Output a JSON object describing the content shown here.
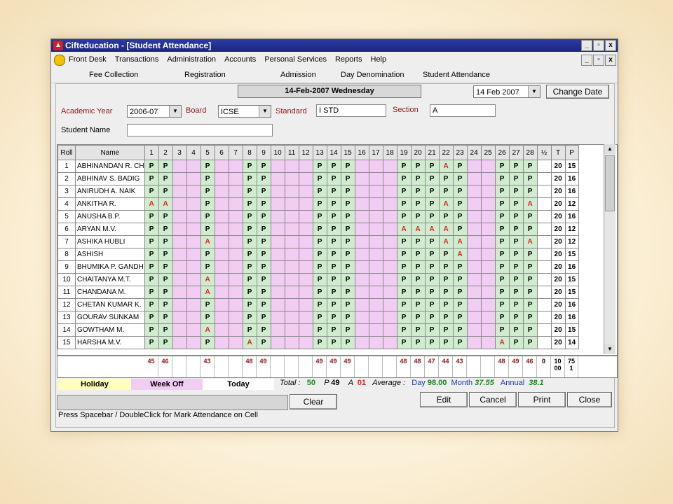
{
  "window": {
    "title": "Cifteducation - [Student Attendance]",
    "min_btn": "_",
    "restore_btn": "▫",
    "close_btn": "x"
  },
  "menu": [
    "Front Desk",
    "Transactions",
    "Administration",
    "Accounts",
    "Personal Services",
    "Reports",
    "Help"
  ],
  "toolbar": [
    "Fee Collection",
    "Registration",
    "Admission",
    "Day Denomination",
    "Student Attendance"
  ],
  "date_display": "14-Feb-2007  Wednesday",
  "date_select": "14 Feb 2007",
  "change_date_label": "Change Date",
  "filters": {
    "academic_year_label": "Academic Year",
    "academic_year": "2006-07",
    "board_label": "Board",
    "board": "ICSE",
    "standard_label": "Standard",
    "standard": "I STD",
    "section_label": "Section",
    "section": "A",
    "student_name_label": "Student Name",
    "student_name": ""
  },
  "grid": {
    "headers": [
      "Roll",
      "Name",
      "1",
      "2",
      "3",
      "4",
      "5",
      "6",
      "7",
      "8",
      "9",
      "10",
      "11",
      "12",
      "13",
      "14",
      "15",
      "16",
      "17",
      "18",
      "19",
      "20",
      "21",
      "22",
      "23",
      "24",
      "25",
      "26",
      "27",
      "28",
      "½",
      "T",
      "P"
    ],
    "holiday_cols": [
      3,
      4,
      6,
      7,
      10,
      11,
      12,
      16,
      17,
      18,
      24,
      25
    ],
    "rows": [
      {
        "roll": "1",
        "name": "ABHINANDAN R. CH",
        "marks": "PP..P..PP...PPP...PPPAP..PPP",
        "t": "20",
        "p": "15"
      },
      {
        "roll": "2",
        "name": "ABHINAV S. BADIG",
        "marks": "PP..P..PP...PPP...PPPPP..PPP",
        "t": "20",
        "p": "16"
      },
      {
        "roll": "3",
        "name": "ANIRUDH A. NAIK",
        "marks": "PP..P..PP...PPP...PPPPP..PPP",
        "t": "20",
        "p": "16"
      },
      {
        "roll": "4",
        "name": "ANKITHA R.",
        "marks": "AA..P..PP...PPP...PPPAP..PPA",
        "t": "20",
        "p": "12"
      },
      {
        "roll": "5",
        "name": "ANUSHA B.P.",
        "marks": "PP..P..PP...PPP...PPPPP..PPP",
        "t": "20",
        "p": "16"
      },
      {
        "roll": "6",
        "name": "ARYAN M.V.",
        "marks": "PP..P..PP...PPP...AAAAP..PPP",
        "t": "20",
        "p": "12"
      },
      {
        "roll": "7",
        "name": "ASHIKA HUBLI",
        "marks": "PP..A..PP...PPP...PPPAA..PPA",
        "t": "20",
        "p": "12"
      },
      {
        "roll": "8",
        "name": "ASHISH",
        "marks": "PP..P..PP...PPP...PPPPA..PPP",
        "t": "20",
        "p": "15"
      },
      {
        "roll": "9",
        "name": "BHUMIKA P. GANDH",
        "marks": "PP..P..PP...PPP...PPPPP..PPP",
        "t": "20",
        "p": "16"
      },
      {
        "roll": "10",
        "name": "CHAITANYA M.T.",
        "marks": "PP..A..PP...PPP...PPPPP..PPP",
        "t": "20",
        "p": "15"
      },
      {
        "roll": "11",
        "name": "CHANDANA M.",
        "marks": "PP..A..PP...PPP...PPPPP..PPP",
        "t": "20",
        "p": "15"
      },
      {
        "roll": "12",
        "name": "CHETAN KUMAR K.",
        "marks": "PP..P..PP...PPP...PPPPP..PPP",
        "t": "20",
        "p": "16"
      },
      {
        "roll": "13",
        "name": "GOURAV SUNKAM",
        "marks": "PP..P..PP...PPP...PPPPP..PPP",
        "t": "20",
        "p": "16"
      },
      {
        "roll": "14",
        "name": "GOWTHAM M.",
        "marks": "PP..A..PP...PPP...PPPPP..PPP",
        "t": "20",
        "p": "15"
      },
      {
        "roll": "15",
        "name": "HARSHA M.V.",
        "marks": "PP..P..AP...PPP...PPPPP..APP",
        "t": "20",
        "p": "14"
      }
    ],
    "summary": [
      "45",
      "46",
      "",
      "",
      "43",
      "",
      "",
      "48",
      "49",
      "",
      "",
      "",
      "49",
      "49",
      "49",
      "",
      "",
      "",
      "48",
      "48",
      "47",
      "44",
      "43",
      "",
      "",
      "48",
      "49",
      "46",
      "0",
      "10\n00",
      "75\n1"
    ]
  },
  "legend": {
    "holiday": "Holiday",
    "week_off": "Week Off",
    "today": "Today"
  },
  "stats": {
    "total_label": "Total :",
    "total": "50",
    "p_label": "P",
    "p": "49",
    "a_label": "A",
    "a": "01",
    "average_label": "Average :",
    "day_label": "Day",
    "day": "98.00",
    "month_label": "Month",
    "month": "37.55",
    "annual_label": "Annual",
    "annual": "38.1"
  },
  "buttons": {
    "clear": "Clear",
    "edit": "Edit",
    "cancel": "Cancel",
    "print": "Print",
    "close": "Close"
  },
  "hint": "Press Spacebar / DoubleClick for Mark Attendance on Cell",
  "colors": {
    "present_bg": "#cfeccf",
    "holiday_bg": "#f1ccf3",
    "absent": "#e52020",
    "legend_holiday": "#ffffc0",
    "legend_weekoff": "#f1ccf3"
  }
}
